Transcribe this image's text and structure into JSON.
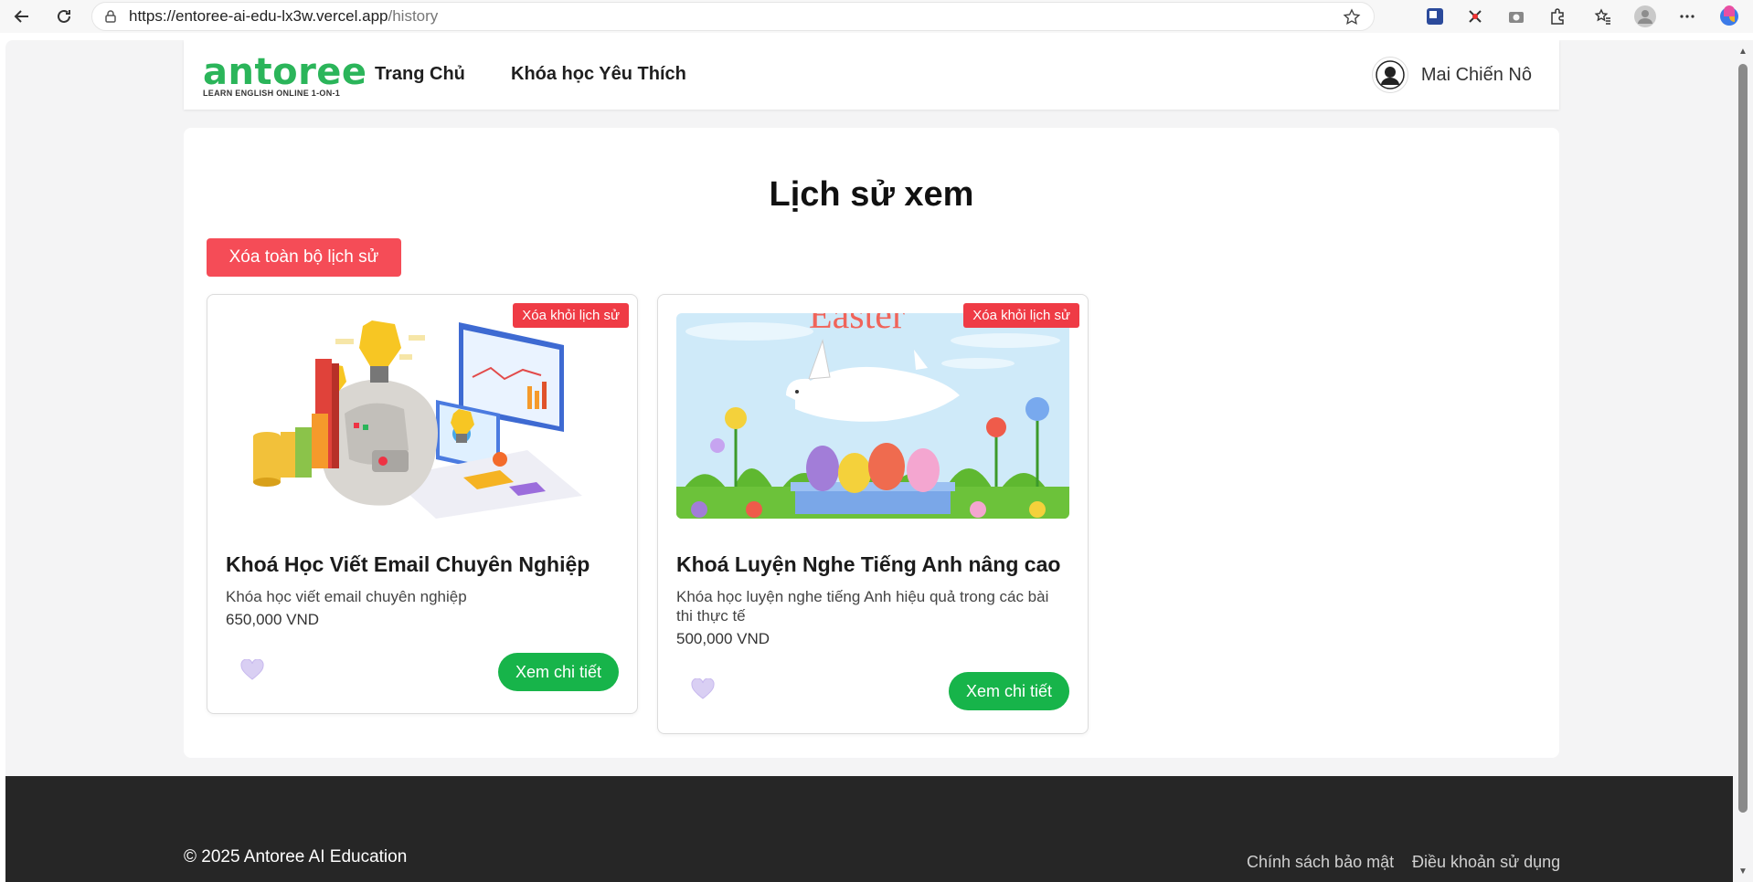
{
  "browser": {
    "url_host": "https://entoree-ai-edu-lx3w.vercel.app",
    "url_path": "/history"
  },
  "header": {
    "logo_word": "antoree",
    "logo_tagline": "LEARN ENGLISH ONLINE 1-ON-1",
    "nav": [
      {
        "label": "Trang Chủ"
      },
      {
        "label": "Khóa học Yêu Thích"
      }
    ],
    "user_name": "Mai Chiến Nô"
  },
  "main": {
    "title": "Lịch sử xem",
    "clear_all_label": "Xóa toàn bộ lịch sử",
    "cards": [
      {
        "remove_label": "Xóa khỏi lịch sử",
        "title": "Khoá Học Viết Email Chuyên Nghiệp",
        "description": "Khóa học viết email chuyên nghiệp",
        "price": "650,000 VND",
        "detail_label": "Xem chi tiết"
      },
      {
        "remove_label": "Xóa khỏi lịch sử",
        "image_text": "Easter",
        "title": "Khoá Luyện Nghe Tiếng Anh nâng cao",
        "description": "Khóa học luyện nghe tiếng Anh hiệu quả trong các bài thi thực tế",
        "price": "500,000 VND",
        "detail_label": "Xem chi tiết"
      }
    ]
  },
  "footer": {
    "copyright": "© 2025 Antoree AI Education",
    "links": [
      {
        "label": "Chính sách bảo mật"
      },
      {
        "label": "Điều khoản sử dụng"
      }
    ]
  },
  "colors": {
    "brand_green": "#2bb55a",
    "danger_red": "#ef3b45",
    "action_green": "#17b44a",
    "footer_bg": "#262626"
  }
}
